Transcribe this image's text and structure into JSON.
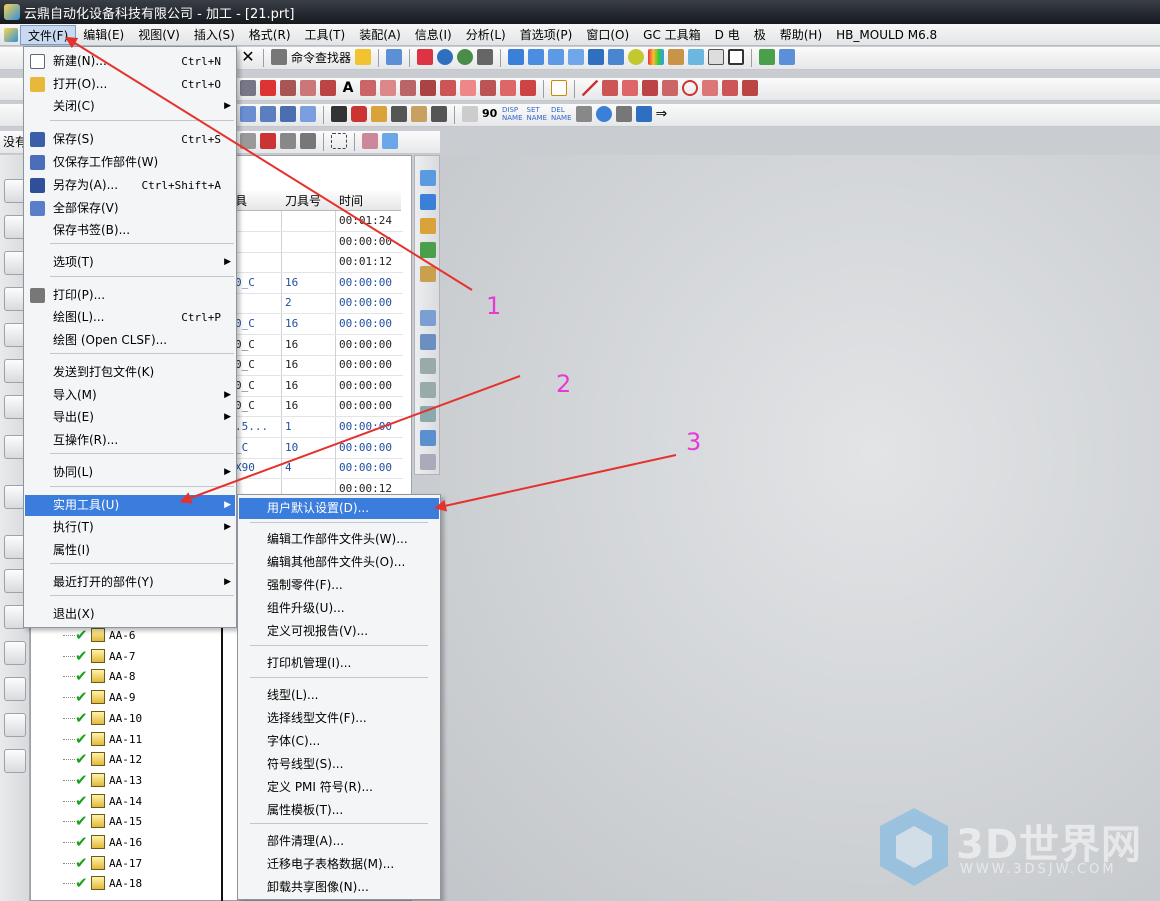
{
  "window": {
    "title": "云鼎自动化设备科技有限公司 - 加工 - [21.prt]"
  },
  "menubar": {
    "items": [
      "文件(F)",
      "编辑(E)",
      "视图(V)",
      "插入(S)",
      "格式(R)",
      "工具(T)",
      "装配(A)",
      "信息(I)",
      "分析(L)",
      "首选项(P)",
      "窗口(O)",
      "GC 工具箱",
      "D 电",
      "极",
      "帮助(H)",
      "HB_MOULD M6.8"
    ]
  },
  "toolbar": {
    "command_finder": "命令查找器",
    "disp": "DISP\nNAME",
    "set": "SET\nNAME",
    "del": "DEL\nNAME",
    "row4_label": "没有"
  },
  "grid": {
    "headers": [
      "具",
      "刀具号",
      "时间"
    ],
    "rows": [
      {
        "tool": "",
        "num": "",
        "time": "00:01:24",
        "dark": true
      },
      {
        "tool": "",
        "num": "",
        "time": "00:00:00",
        "dark": true
      },
      {
        "tool": "",
        "num": "",
        "time": "00:01:12",
        "dark": true
      },
      {
        "tool": "0_C",
        "num": "16",
        "time": "00:00:00",
        "dark": false
      },
      {
        "tool": "",
        "num": "2",
        "time": "00:00:00",
        "dark": false
      },
      {
        "tool": "0_C",
        "num": "16",
        "time": "00:00:00",
        "dark": false
      },
      {
        "tool": "0_C",
        "num": "16",
        "time": "00:00:00",
        "dark": true
      },
      {
        "tool": "0_C",
        "num": "16",
        "time": "00:00:00",
        "dark": true
      },
      {
        "tool": "0_C",
        "num": "16",
        "time": "00:00:00",
        "dark": true
      },
      {
        "tool": "0_C",
        "num": "16",
        "time": "00:00:00",
        "dark": true
      },
      {
        "tool": ".5...",
        "num": "1",
        "time": "00:00:00",
        "dark": false
      },
      {
        "tool": "_C",
        "num": "10",
        "time": "00:00:00",
        "dark": false
      },
      {
        "tool": "X90",
        "num": "4",
        "time": "00:00:00",
        "dark": false
      },
      {
        "tool": "",
        "num": "",
        "time": "00:00:12",
        "dark": true
      }
    ]
  },
  "tree": {
    "ops": [
      "AA-6",
      "AA-7",
      "AA-8",
      "AA-9",
      "AA-10",
      "AA-11",
      "AA-12",
      "AA-13",
      "AA-14",
      "AA-15",
      "AA-16",
      "AA-17",
      "AA-18"
    ]
  },
  "file_menu": {
    "items": [
      {
        "label": "新建(N)...",
        "shortcut": "Ctrl+N",
        "icon": "new-file-icon"
      },
      {
        "label": "打开(O)...",
        "shortcut": "Ctrl+O",
        "icon": "open-folder-icon"
      },
      {
        "label": "关闭(C)",
        "submenu": true
      },
      {
        "label": "保存(S)",
        "shortcut": "Ctrl+S",
        "icon": "save-icon"
      },
      {
        "label": "仅保存工作部件(W)",
        "icon": "save-work-part-icon"
      },
      {
        "label": "另存为(A)...",
        "shortcut": "Ctrl+Shift+A",
        "icon": "save-as-icon"
      },
      {
        "label": "全部保存(V)",
        "icon": "save-all-icon"
      },
      {
        "label": "保存书签(B)..."
      },
      {
        "label": "选项(T)",
        "submenu": true
      },
      {
        "label": "打印(P)...",
        "icon": "print-icon"
      },
      {
        "label": "绘图(L)...",
        "shortcut": "Ctrl+P"
      },
      {
        "label": "绘图 (Open CLSF)..."
      },
      {
        "label": "发送到打包文件(K)"
      },
      {
        "label": "导入(M)",
        "submenu": true
      },
      {
        "label": "导出(E)",
        "submenu": true
      },
      {
        "label": "互操作(R)..."
      },
      {
        "label": "协同(L)",
        "submenu": true
      },
      {
        "label": "实用工具(U)",
        "submenu": true
      },
      {
        "label": "执行(T)",
        "submenu": true
      },
      {
        "label": "属性(I)"
      },
      {
        "label": "最近打开的部件(Y)",
        "submenu": true
      },
      {
        "label": "退出(X)"
      }
    ]
  },
  "util_menu": {
    "items": [
      "用户默认设置(D)...",
      "编辑工作部件文件头(W)...",
      "编辑其他部件文件头(O)...",
      "强制零件(F)...",
      "组件升级(U)...",
      "定义可视报告(V)...",
      "打印机管理(I)...",
      "线型(L)...",
      "选择线型文件(F)...",
      "字体(C)...",
      "符号线型(S)...",
      "定义 PMI 符号(R)...",
      "属性模板(T)...",
      "部件清理(A)...",
      "迁移电子表格数据(M)...",
      "卸载共享图像(N)..."
    ]
  },
  "annotations": {
    "n1": "1",
    "n2": "2",
    "n3": "3",
    "color": "#e63ad7"
  },
  "watermark": {
    "title": "3D世界网",
    "url": "WWW.3DSJW.COM"
  }
}
